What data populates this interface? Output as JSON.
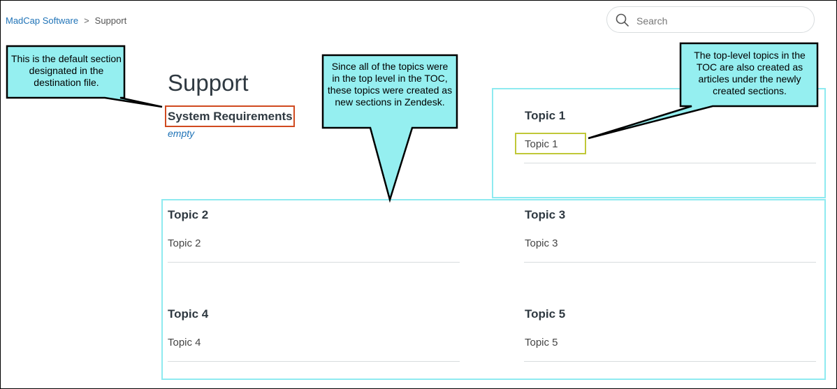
{
  "breadcrumb": {
    "home": "MadCap Software",
    "separator": ">",
    "current": "Support"
  },
  "search": {
    "placeholder": "Search"
  },
  "page": {
    "title": "Support"
  },
  "default_section": {
    "title": "System Requirements",
    "empty_label": "empty"
  },
  "sections": [
    {
      "title": "Topic 1",
      "articles": [
        "Topic 1"
      ]
    },
    {
      "title": "Topic 2",
      "articles": [
        "Topic 2"
      ]
    },
    {
      "title": "Topic 3",
      "articles": [
        "Topic 3"
      ]
    },
    {
      "title": "Topic 4",
      "articles": [
        "Topic 4"
      ]
    },
    {
      "title": "Topic 5",
      "articles": [
        "Topic 5"
      ]
    }
  ],
  "callouts": {
    "default_section": "This is the default section designated in the destination file.",
    "new_sections": "Since all of the topics were in the top level in the TOC, these topics were created as new sections in Zendesk.",
    "articles": "The top-level topics in the TOC are also created as articles under the newly created sections."
  },
  "colors": {
    "link": "#1f73b7",
    "callout_fill": "#95eff0",
    "section_box": "#8eeaf0",
    "sysreq_border": "#d04a1f",
    "article_highlight": "#c0c838"
  }
}
